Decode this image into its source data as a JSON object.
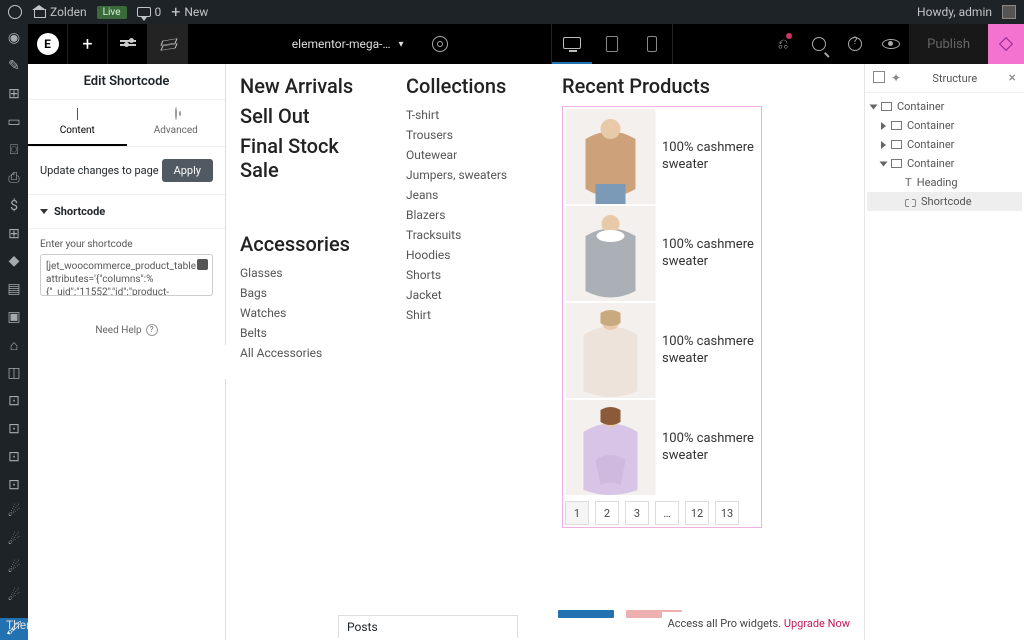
{
  "adminbar": {
    "site": "Zolden",
    "live": "Live",
    "comments": "0",
    "new": "New",
    "howdy": "Howdy, admin"
  },
  "wp_sidebar": {
    "themes": "Themes"
  },
  "elementor": {
    "doc": "elementor-mega-…",
    "publish": "Publish"
  },
  "panel": {
    "title": "Edit Shortcode",
    "tab_content": "Content",
    "tab_advanced": "Advanced",
    "update_note": "Update changes to page",
    "apply": "Apply",
    "section": "Shortcode",
    "field_label": "Enter your shortcode",
    "shortcode_value": "[jet_woocommerce_product_table attributes='{\"columns\":%\n{\"_uid\":\"11552\",\"id\":\"product-\nimage\",\"label\":\"Product",
    "need_help": "Need Help"
  },
  "canvas": {
    "col1": {
      "h1": "New Arrivals",
      "h2": "Sell Out",
      "h3": "Final Stock Sale",
      "acc_title": "Accessories",
      "acc": [
        "Glasses",
        "Bags",
        "Watches",
        "Belts",
        "All Accessories"
      ]
    },
    "col2": {
      "title": "Collections",
      "items": [
        "T-shirt",
        "Trousers",
        "Outewear",
        "Jumpers, sweaters",
        "Jeans",
        "Blazers",
        "Tracksuits",
        "Hoodies",
        "Shorts",
        "Jacket",
        "Shirt"
      ]
    },
    "col3": {
      "title": "Recent Products",
      "item_label": "100% cashmere sweater",
      "pager": [
        "1",
        "2",
        "3",
        "…",
        "12",
        "13"
      ]
    },
    "pro": {
      "text": "Access all Pro widgets.",
      "link": "Upgrade Now"
    },
    "posts": "Posts"
  },
  "structure": {
    "title": "Structure",
    "container": "Container",
    "heading": "Heading",
    "shortcode": "Shortcode"
  }
}
